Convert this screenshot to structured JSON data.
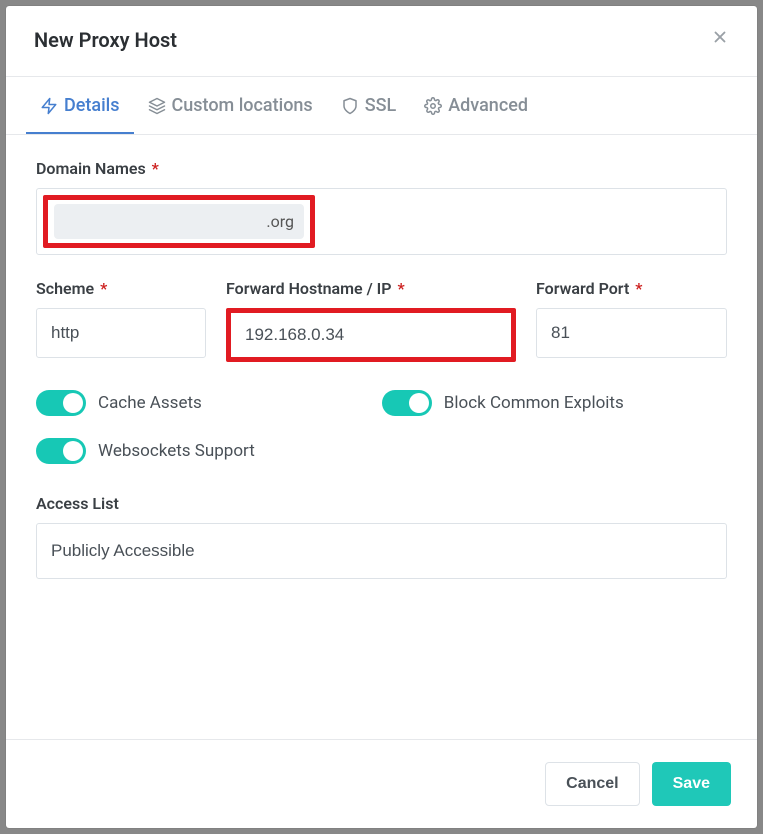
{
  "modal": {
    "title": "New Proxy Host"
  },
  "tabs": {
    "details": "Details",
    "custom_locations": "Custom locations",
    "ssl": "SSL",
    "advanced": "Advanced"
  },
  "labels": {
    "domain_names": "Domain Names",
    "scheme": "Scheme",
    "forward_hostname": "Forward Hostname / IP",
    "forward_port": "Forward Port",
    "access_list": "Access List"
  },
  "values": {
    "domain_chip": ".org",
    "scheme": "http",
    "forward_hostname": "192.168.0.34",
    "forward_port": "81",
    "access_list": "Publicly Accessible"
  },
  "toggles": {
    "cache_assets": "Cache Assets",
    "block_exploits": "Block Common Exploits",
    "websockets": "Websockets Support"
  },
  "footer": {
    "cancel": "Cancel",
    "save": "Save"
  }
}
